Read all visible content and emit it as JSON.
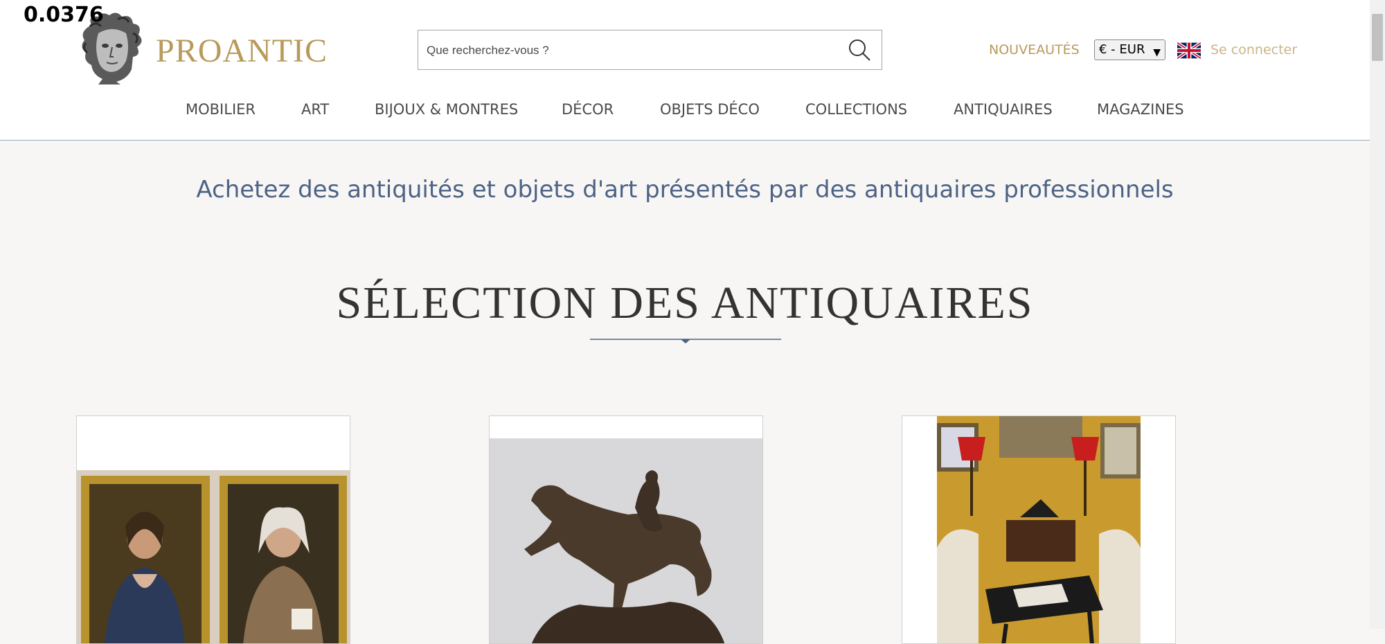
{
  "overlay": {
    "value": "0.0376"
  },
  "header": {
    "logo_text": "PROANTIC",
    "search": {
      "placeholder": "Que recherchez-vous ?",
      "value": ""
    },
    "nouveautes_label": "NOUVEAUTÉS",
    "currency": {
      "selected": "€ - EUR"
    },
    "language_flag": "uk-flag-icon",
    "connect_label": "Se connecter"
  },
  "nav": {
    "items": [
      {
        "label": "MOBILIER"
      },
      {
        "label": "ART"
      },
      {
        "label": "BIJOUX & MONTRES"
      },
      {
        "label": "DÉCOR"
      },
      {
        "label": "OBJETS DÉCO"
      },
      {
        "label": "COLLECTIONS"
      },
      {
        "label": "ANTIQUAIRES"
      },
      {
        "label": "MAGAZINES"
      }
    ]
  },
  "main": {
    "tagline": "Achetez des antiquités et objets d'art présentés par des antiquaires professionnels",
    "section_title": "SÉLECTION DES ANTIQUAIRES"
  },
  "products": [
    {
      "image": "pair-of-portrait-paintings"
    },
    {
      "image": "bronze-horse-and-jockey-sculpture"
    },
    {
      "image": "antique-interior-with-chess-table"
    }
  ],
  "colors": {
    "brand_gold": "#b89a5a",
    "tagline_blue": "#4d6385",
    "page_background": "#f7f6f5"
  }
}
